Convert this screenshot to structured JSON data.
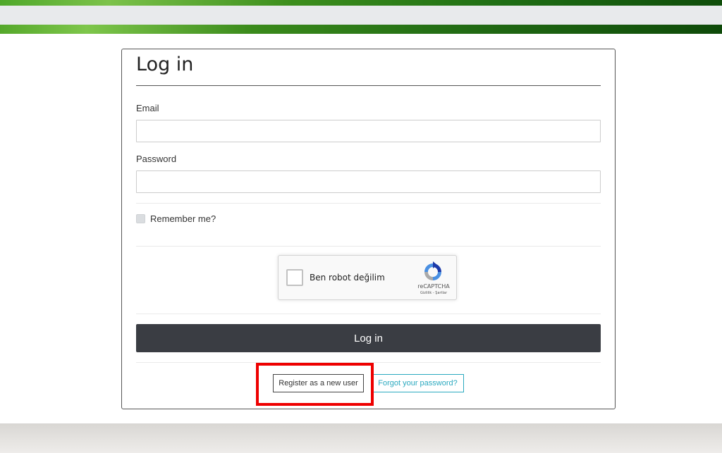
{
  "header": {
    "brand_colors": [
      "#4fa82a",
      "#1f6e14",
      "#0f4d0a"
    ]
  },
  "login_form": {
    "title": "Log in",
    "email_label": "Email",
    "email_value": "",
    "password_label": "Password",
    "password_value": "",
    "remember_label": "Remember me?",
    "remember_checked": false,
    "login_button_label": "Log in",
    "register_button_label": "Register as a new user",
    "forgot_button_label": "Forgot your password?"
  },
  "recaptcha": {
    "checkbox_label": "Ben robot değilim",
    "brand": "reCAPTCHA",
    "links": "Gizlilik - Şartlar",
    "logo_icon": "recaptcha-logo-icon"
  },
  "highlight": {
    "color": "#ee0000",
    "target": "register-button"
  },
  "colors": {
    "login_button_bg": "#3a3d43",
    "forgot_link": "#2aa9bf"
  }
}
